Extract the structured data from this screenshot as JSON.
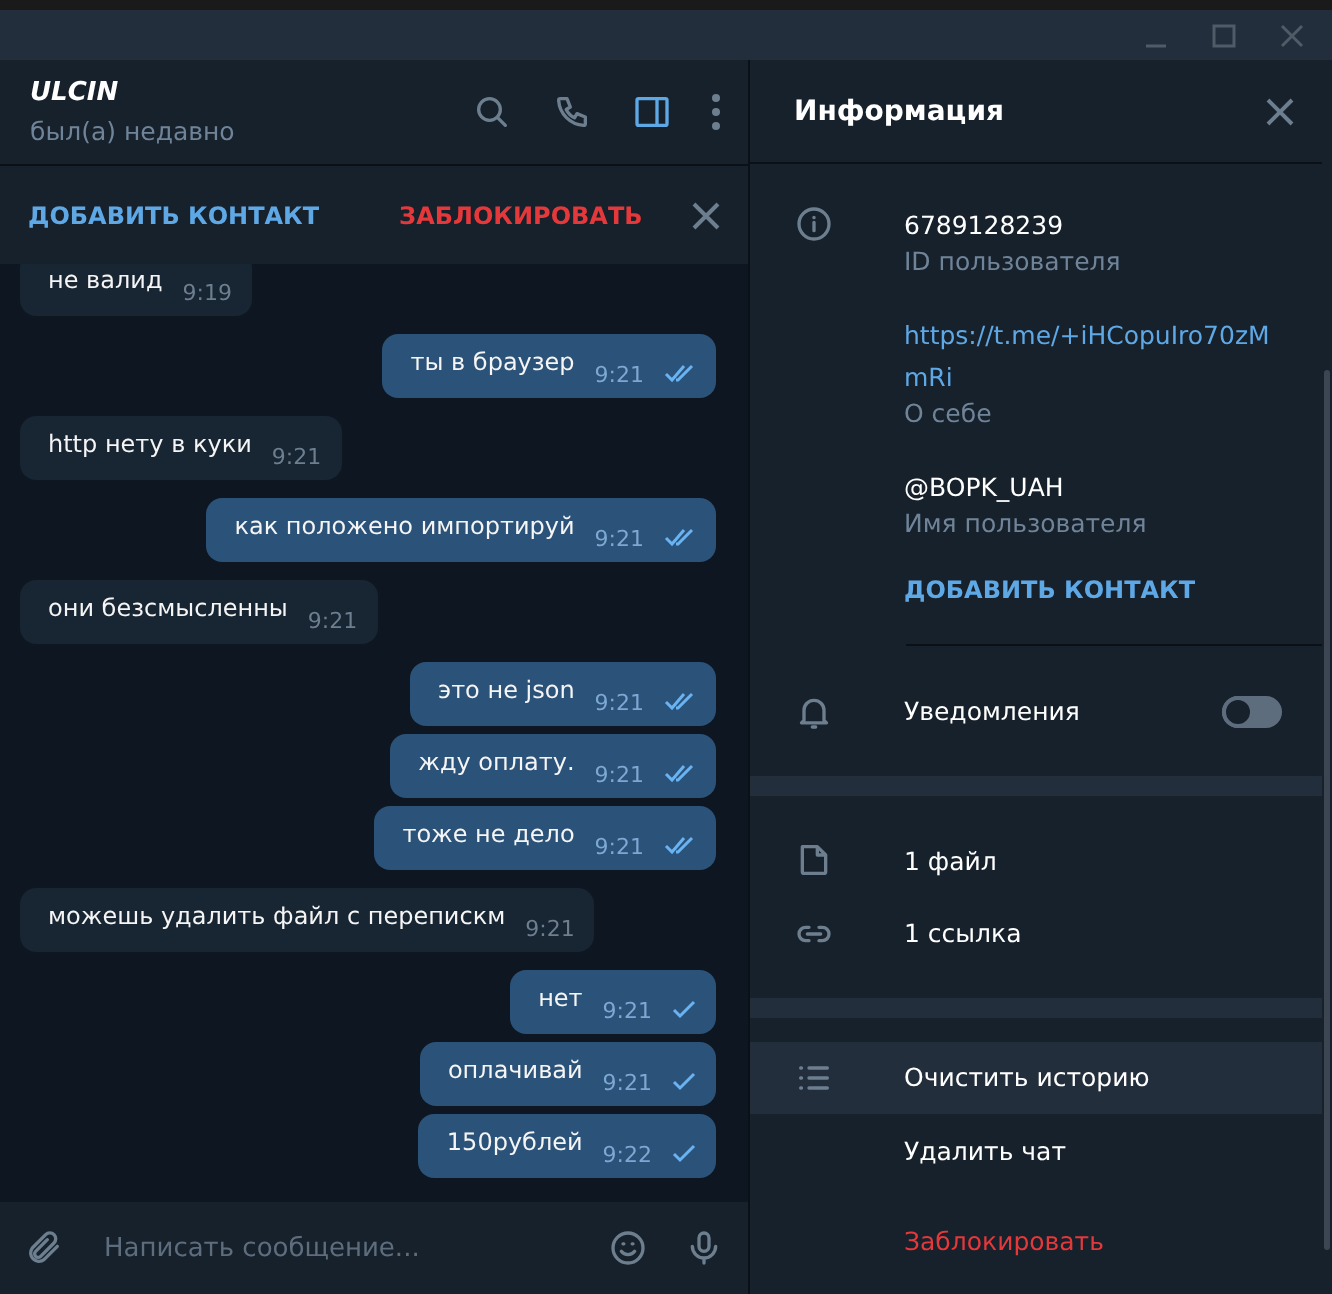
{
  "chat": {
    "name": "ULCIN",
    "status": "был(а) недавно"
  },
  "action_bar": {
    "add": "ДОБАВИТЬ КОНТАКТ",
    "block": "ЗАБЛОКИРОВАТЬ"
  },
  "messages": [
    {
      "kind": "in",
      "text": "не валид",
      "time": "9:19"
    },
    {
      "kind": "out",
      "text": "ты в браузер",
      "time": "9:21",
      "read": true
    },
    {
      "kind": "in",
      "text": "http нету в куки",
      "time": "9:21"
    },
    {
      "kind": "out",
      "text": "как положено импортируй",
      "time": "9:21",
      "read": true
    },
    {
      "kind": "in",
      "text": "они безсмысленны",
      "time": "9:21"
    },
    {
      "kind": "out",
      "text": "это не json",
      "time": "9:21",
      "read": true
    },
    {
      "kind": "out",
      "text": "жду оплату.",
      "time": "9:21",
      "read": true
    },
    {
      "kind": "out",
      "text": "тоже не дело",
      "time": "9:21",
      "read": true
    },
    {
      "kind": "in",
      "text": "можешь удалить файл с перепискм",
      "time": "9:21"
    },
    {
      "kind": "out",
      "text": "нет",
      "time": "9:21",
      "read": false
    },
    {
      "kind": "out",
      "text": "оплачивай",
      "time": "9:21",
      "read": false
    },
    {
      "kind": "out",
      "text": "150рублей",
      "time": "9:22",
      "read": false
    }
  ],
  "composer": {
    "placeholder": "Написать сообщение..."
  },
  "info_panel": {
    "title": "Информация",
    "fields": [
      {
        "value": "6789128239",
        "label": "ID пользователя",
        "kind": "text"
      },
      {
        "value": "https://t.me/+iHCopuIro70zMmRi",
        "label": "О себе",
        "kind": "link"
      },
      {
        "value": "@BOPK_UAH",
        "label": "Имя пользователя",
        "kind": "text"
      }
    ],
    "add_contact": "ДОБАВИТЬ КОНТАКТ",
    "notifications": {
      "label": "Уведомления",
      "on": false
    },
    "media": [
      {
        "kind": "file",
        "label": "1 файл"
      },
      {
        "kind": "link",
        "label": "1 ссылка"
      }
    ],
    "actions": [
      {
        "kind": "clear",
        "label": "Очистить историю",
        "highlighted": true
      },
      {
        "kind": "delete",
        "label": "Удалить чат",
        "highlighted": false
      },
      {
        "kind": "block",
        "label": "Заблокировать",
        "highlighted": false
      }
    ]
  }
}
